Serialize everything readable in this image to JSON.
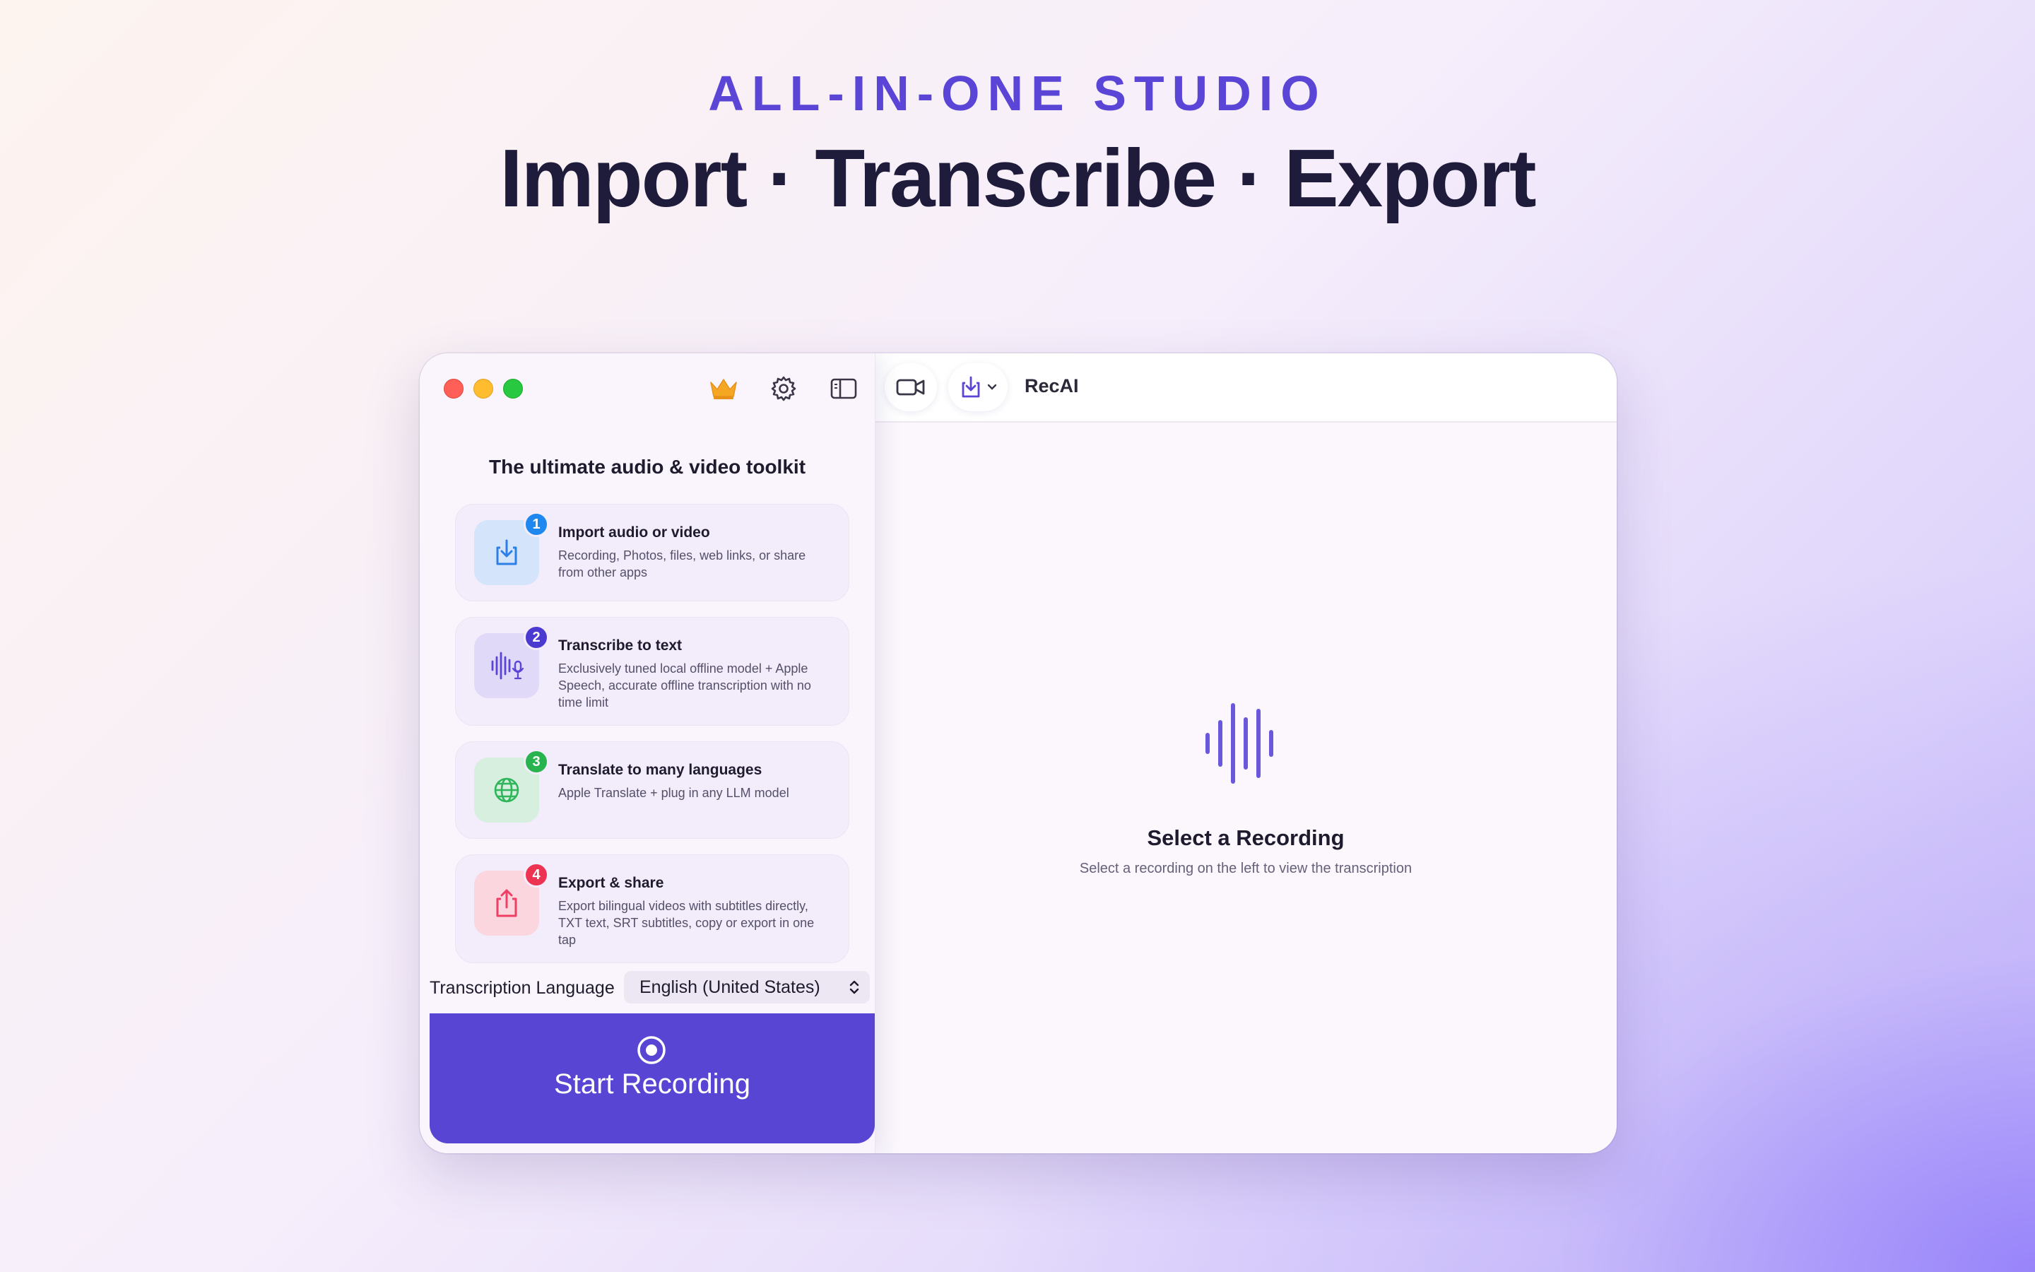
{
  "hero": {
    "eyebrow": "ALL-IN-ONE STUDIO",
    "title": "Import · Transcribe · Export"
  },
  "toolbar": {
    "app_title": "RecAI",
    "icons": [
      "crown-icon",
      "gear-icon",
      "sidebar-toggle-icon",
      "video-camera-icon",
      "import-icon",
      "chevron-down-icon"
    ]
  },
  "sidebar": {
    "heading": "The ultimate audio & video toolkit",
    "cards": [
      {
        "number": "1",
        "title": "Import audio or video",
        "desc": "Recording, Photos, files, web links, or share from other apps",
        "icon": "import-icon",
        "color": "#2b7fe6"
      },
      {
        "number": "2",
        "title": "Transcribe to text",
        "desc": "Exclusively tuned local offline model + Apple Speech, accurate offline transcription with no time limit",
        "icon": "waveform-mic-icon",
        "color": "#5a45d6"
      },
      {
        "number": "3",
        "title": "Translate to many languages",
        "desc": "Apple Translate + plug in any LLM model",
        "icon": "globe-icon",
        "color": "#2fb55a"
      },
      {
        "number": "4",
        "title": "Export & share",
        "desc": "Export bilingual videos with subtitles directly, TXT text, SRT subtitles, copy or export in one tap",
        "icon": "share-icon",
        "color": "#ee3f64"
      }
    ],
    "language_label": "Transcription Language",
    "language_value": "English (United States)",
    "record_label": "Start Recording"
  },
  "empty_state": {
    "title": "Select a Recording",
    "subtitle": "Select a recording on the left to view the transcription",
    "icon": "waveform-icon"
  }
}
